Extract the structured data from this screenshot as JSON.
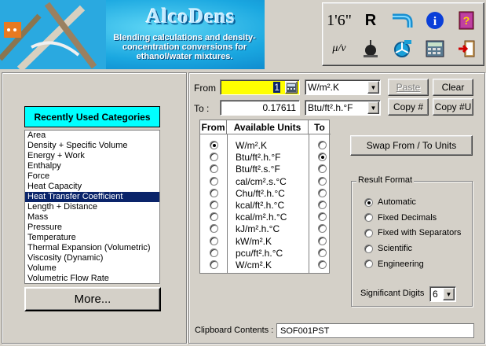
{
  "banner": {
    "logo": "AlcoDens",
    "description": "Blending calculations and density-concentration conversions for ethanol/water mixtures."
  },
  "toolbar": {
    "length_label": "1'6\"",
    "r_label": "R",
    "mu_label": "μ/ν"
  },
  "categories": {
    "header": "Recently Used Categories",
    "items": [
      "Area",
      "Density + Specific Volume",
      "Energy + Work",
      "Enthalpy",
      "Force",
      "Heat Capacity",
      "Heat Transfer Coefficient",
      "Length + Distance",
      "Mass",
      "Pressure",
      "Temperature",
      "Thermal Expansion (Volumetric)",
      "Viscosity (Dynamic)",
      "Volume",
      "Volumetric Flow Rate"
    ],
    "selected_index": 6,
    "more_label": "More..."
  },
  "convert": {
    "from_label": "From",
    "to_label": "To :",
    "from_value": "1",
    "to_value": "0.17611",
    "from_unit": "W/m².K",
    "to_unit": "Btu/ft².h.°F",
    "paste_label": "Paste",
    "clear_label": "Clear",
    "copy_label": "Copy #",
    "copy_u_label": "Copy #U"
  },
  "units": {
    "col_from": "From",
    "col_units": "Available Units",
    "col_to": "To",
    "list": [
      "W/m².K",
      "Btu/ft².h.°F",
      "Btu/ft².s.°F",
      "cal/cm².s.°C",
      "Chu/ft².h.°C",
      "kcal/ft².h.°C",
      "kcal/m².h.°C",
      "kJ/m².h.°C",
      "kW/m².K",
      "pcu/ft².h.°C",
      "W/cm².K"
    ],
    "from_selected": 0,
    "to_selected": 1
  },
  "swap_label": "Swap From / To  Units",
  "result_format": {
    "legend": "Result Format",
    "options": [
      "Automatic",
      "Fixed Decimals",
      "Fixed with Separators",
      "Scientific",
      "Engineering"
    ],
    "selected": 0,
    "sig_digits_label": "Significant Digits",
    "sig_digits_value": "6"
  },
  "clipboard": {
    "label": "Clipboard Contents :",
    "value": "SOF001PST"
  }
}
